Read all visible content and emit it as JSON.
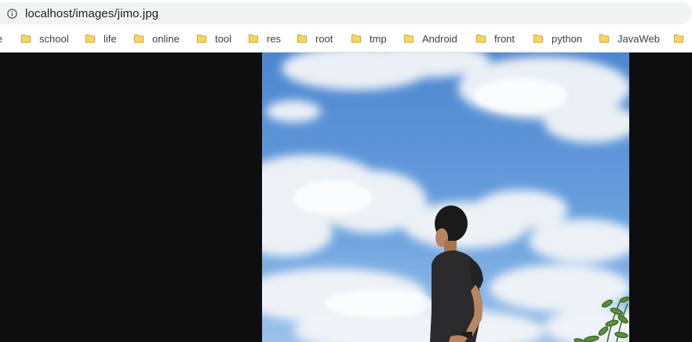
{
  "address_bar": {
    "url": "localhost/images/jimo.jpg",
    "info_icon": "info-icon"
  },
  "bookmarks": {
    "partial_first": "e",
    "items": [
      {
        "label": "school",
        "icon": "folder-icon"
      },
      {
        "label": "life",
        "icon": "folder-icon"
      },
      {
        "label": "online",
        "icon": "folder-icon"
      },
      {
        "label": "tool",
        "icon": "folder-icon"
      },
      {
        "label": "res",
        "icon": "folder-icon"
      },
      {
        "label": "root",
        "icon": "folder-icon"
      },
      {
        "label": "tmp",
        "icon": "folder-icon"
      },
      {
        "label": "Android",
        "icon": "folder-icon"
      },
      {
        "label": "front",
        "icon": "folder-icon"
      },
      {
        "label": "python",
        "icon": "folder-icon"
      },
      {
        "label": "JavaWeb",
        "icon": "folder-icon"
      }
    ]
  },
  "colors": {
    "viewer_background": "#0e0e0e",
    "folder_fill": "#fad566",
    "folder_stroke": "#d3a62e",
    "sky_top": "#4d86cf",
    "sky_bottom": "#9cc2ea",
    "shirt": "#2a2a2c"
  }
}
